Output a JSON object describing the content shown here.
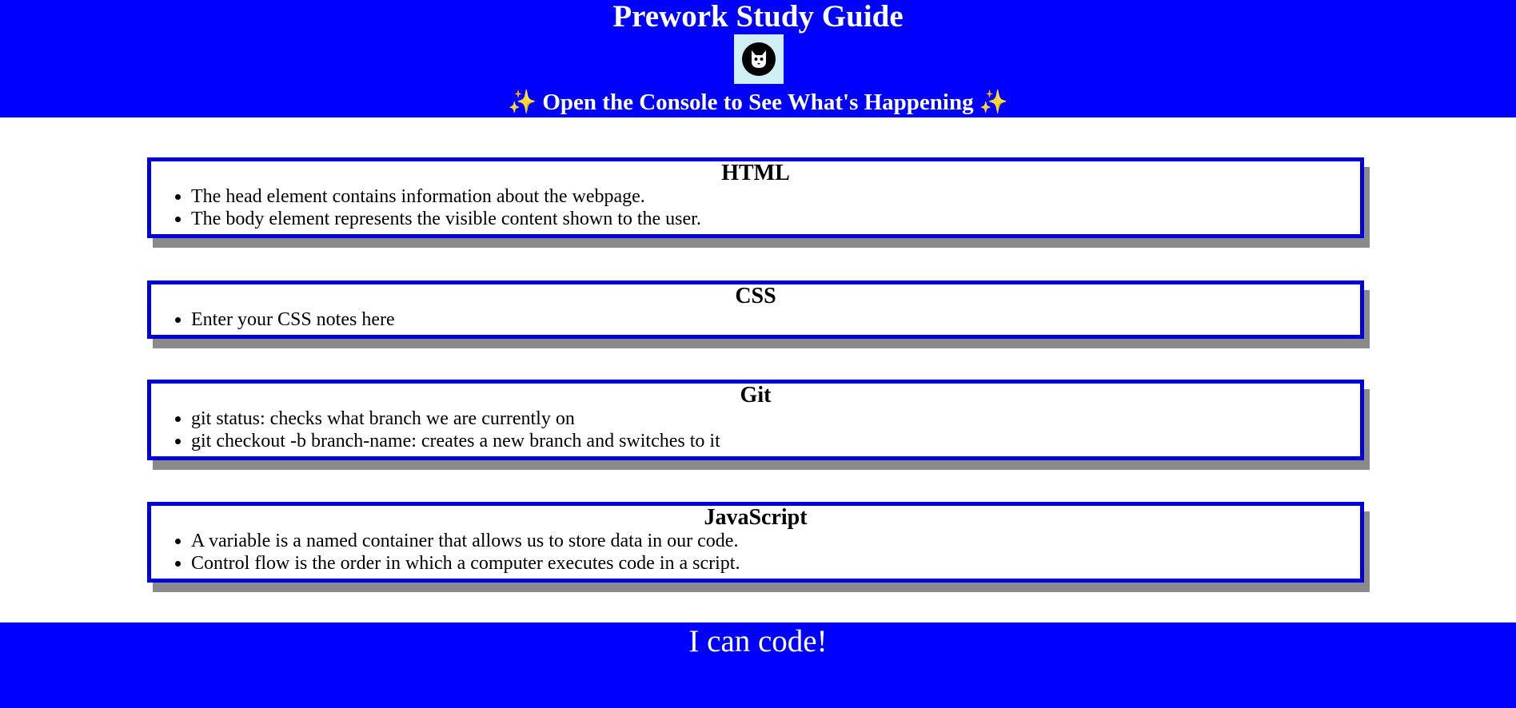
{
  "header": {
    "title": "Prework Study Guide",
    "subtitle_text": "Open the Console to See What's Happening",
    "sparkle_left": "✨",
    "sparkle_right": "✨",
    "logo_icon": "cat-logo-icon",
    "colors": {
      "background": "#0000ff",
      "logo_background": "#cfeff4"
    }
  },
  "sections": [
    {
      "heading": "HTML",
      "items": [
        "The head element contains information about the webpage.",
        "The body element represents the visible content shown to the user."
      ]
    },
    {
      "heading": "CSS",
      "items": [
        "Enter your CSS notes here"
      ]
    },
    {
      "heading": "Git",
      "items": [
        "git status: checks what branch we are currently on",
        "git checkout -b branch-name: creates a new branch and switches to it"
      ]
    },
    {
      "heading": "JavaScript",
      "items": [
        "A variable is a named container that allows us to store data in our code.",
        "Control flow is the order in which a computer executes code in a script."
      ]
    }
  ],
  "footer": {
    "text": "I can code!"
  },
  "colors": {
    "card_border": "#0000dd",
    "card_shadow": "#8a8a8a",
    "footer_background": "#0000ff"
  }
}
